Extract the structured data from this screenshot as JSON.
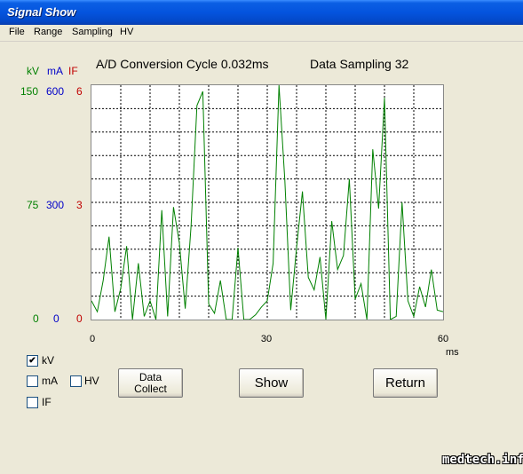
{
  "window": {
    "title": "Signal Show"
  },
  "menu": [
    "File",
    "Range",
    "Sampling",
    "HV"
  ],
  "header": {
    "conversion": "A/D Conversion Cycle 0.032ms",
    "sampling": "Data Sampling 32"
  },
  "axis_labels": {
    "kv": "kV",
    "ma": "mA",
    "if": "IF",
    "kv_ticks": [
      "150",
      "75",
      "0"
    ],
    "ma_ticks": [
      "600",
      "300",
      "0"
    ],
    "if_ticks": [
      "6",
      "3",
      "0"
    ]
  },
  "x_ticks": [
    "0",
    "30",
    "60"
  ],
  "x_unit": "ms",
  "colors": {
    "kv": "#008000",
    "ma": "#0000c8",
    "if": "#c00000",
    "trace": "#008000"
  },
  "checkboxes": [
    {
      "label": "kV",
      "checked": true,
      "mark": "✔"
    },
    {
      "label": "mA",
      "checked": false,
      "mark": ""
    },
    {
      "label": "HV",
      "checked": false,
      "mark": ""
    },
    {
      "label": "IF",
      "checked": false,
      "mark": ""
    }
  ],
  "buttons": {
    "data_collect_1": "Data",
    "data_collect_2": "Collect",
    "show": "Show",
    "return": "Return"
  },
  "watermark": "medtech.info",
  "chart_data": {
    "type": "line",
    "x_unit": "ms",
    "xlim": [
      0,
      60
    ],
    "ylim": [
      0,
      150
    ],
    "y_unit": "kV",
    "grid": true,
    "series": [
      {
        "name": "kV",
        "x": [
          0,
          1,
          2,
          3,
          4,
          5,
          6,
          7,
          8,
          9,
          10,
          11,
          12,
          13,
          14,
          15,
          16,
          17,
          18,
          19,
          20,
          21,
          22,
          23,
          24,
          25,
          26,
          27,
          28,
          29,
          30,
          31,
          32,
          33,
          34,
          35,
          36,
          37,
          38,
          39,
          40,
          41,
          42,
          43,
          44,
          45,
          46,
          47,
          48,
          49,
          50,
          51,
          52,
          53,
          54,
          55,
          56,
          57,
          58,
          59,
          60
        ],
        "values": [
          12,
          5,
          25,
          53,
          5,
          20,
          47,
          0,
          36,
          2,
          12,
          0,
          70,
          2,
          72,
          49,
          7,
          60,
          137,
          146,
          10,
          4,
          25,
          0,
          0,
          46,
          0,
          0,
          3,
          8,
          12,
          36,
          150,
          89,
          6,
          46,
          82,
          27,
          19,
          40,
          0,
          63,
          32,
          41,
          90,
          13,
          23,
          0,
          109,
          71,
          142,
          0,
          2,
          75,
          12,
          2,
          21,
          8,
          32,
          6,
          5
        ]
      }
    ]
  }
}
